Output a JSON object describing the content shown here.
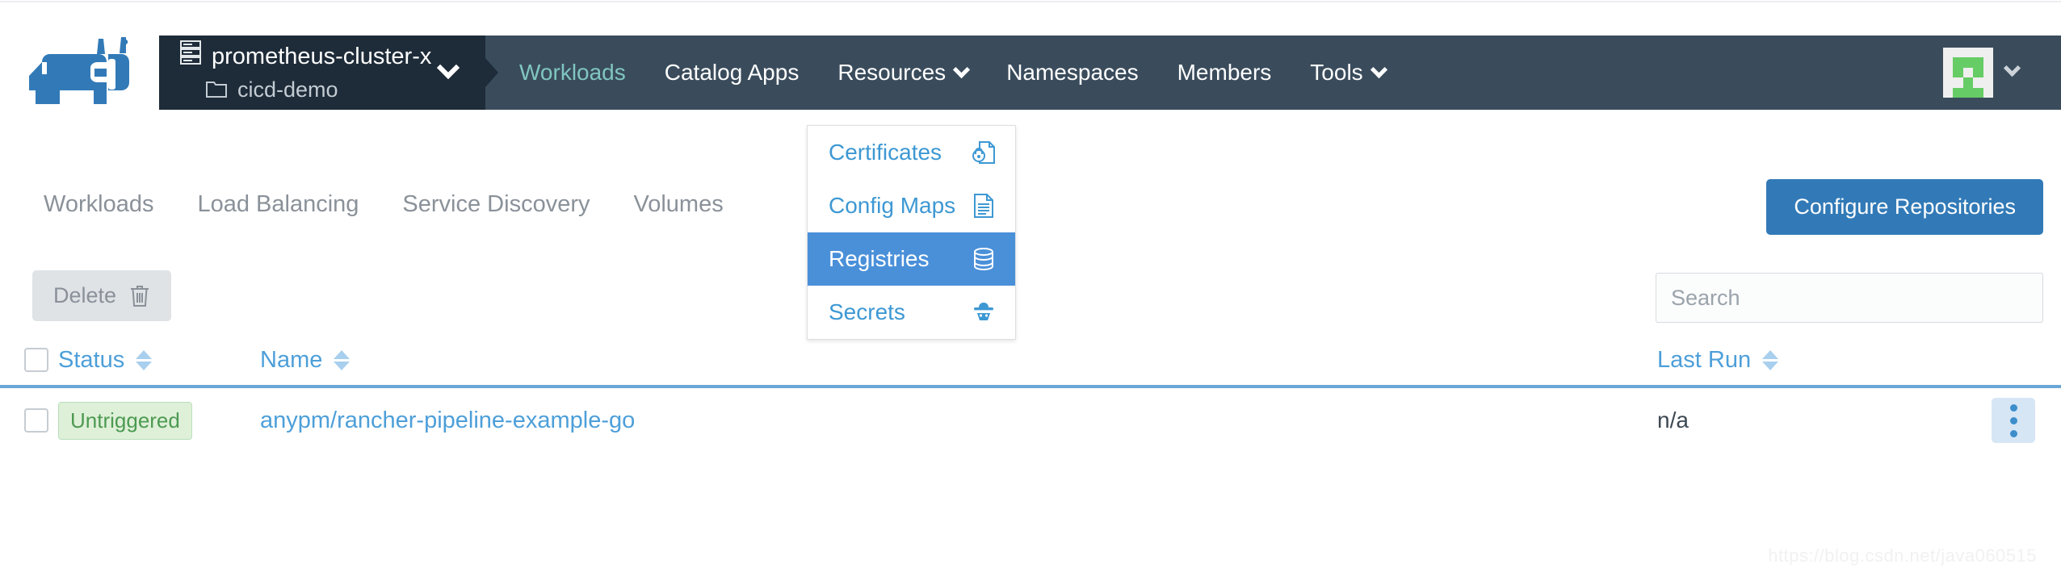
{
  "brand": {
    "logo_name": "rancher-logo",
    "primary_color": "#327ab7",
    "navbar_color": "#3a4c5c",
    "cluster_box_color": "#1e2b38",
    "active_nav_color": "#80c6c0"
  },
  "cluster_selector": {
    "cluster_icon": "server-rack-icon",
    "cluster_name": "prometheus-cluster-x",
    "project_icon": "folder-icon",
    "project_name": "cicd-demo",
    "caret_icon": "chevron-down-icon"
  },
  "navbar": {
    "items": [
      {
        "label": "Workloads",
        "active": true,
        "has_caret": false
      },
      {
        "label": "Catalog Apps",
        "active": false,
        "has_caret": false
      },
      {
        "label": "Resources",
        "active": false,
        "has_caret": true
      },
      {
        "label": "Namespaces",
        "active": false,
        "has_caret": false
      },
      {
        "label": "Members",
        "active": false,
        "has_caret": false
      },
      {
        "label": "Tools",
        "active": false,
        "has_caret": true
      }
    ],
    "user_menu": {
      "avatar_name": "user-avatar-identicon",
      "avatar_color": "#66cc66",
      "caret_icon": "chevron-down-icon"
    }
  },
  "resources_dropdown": {
    "open": true,
    "items": [
      {
        "label": "Certificates",
        "icon": "certificate-lock-icon",
        "glyph": " ",
        "selected": false
      },
      {
        "label": "Config Maps",
        "icon": "document-lines-icon",
        "glyph": " ",
        "selected": false
      },
      {
        "label": "Registries",
        "icon": "database-stack-icon",
        "glyph": " ",
        "selected": true
      },
      {
        "label": "Secrets",
        "icon": "secret-agent-icon",
        "glyph": " ",
        "selected": false
      }
    ]
  },
  "subnav": {
    "items": [
      {
        "label": "Workloads"
      },
      {
        "label": "Load Balancing"
      },
      {
        "label": "Service Discovery"
      },
      {
        "label": "Volumes"
      }
    ],
    "action_button": "Configure Repositories"
  },
  "toolbar": {
    "delete_label": "Delete",
    "delete_icon": "trash-icon",
    "search_placeholder": "Search",
    "search_value": ""
  },
  "table": {
    "select_all_name": "select-all-checkbox",
    "columns": [
      {
        "key": "status",
        "label": "Status",
        "sortable": true
      },
      {
        "key": "name",
        "label": "Name",
        "sortable": true
      },
      {
        "key": "last_run",
        "label": "Last Run",
        "sortable": true
      }
    ],
    "rows": [
      {
        "status": "Untriggered",
        "status_color": "#4c9a52",
        "status_bg": "#dff0d8",
        "name": "anypm/rancher-pipeline-example-go",
        "last_run": "n/a",
        "actions_icon": "kebab-menu-icon"
      }
    ]
  },
  "watermark": "https://blog.csdn.net/java060515"
}
